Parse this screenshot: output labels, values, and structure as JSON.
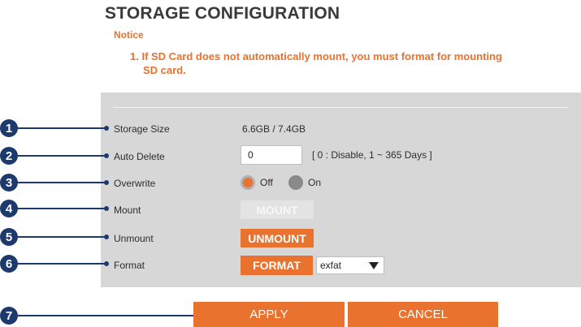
{
  "page": {
    "title": "STORAGE CONFIGURATION",
    "notice_heading": "Notice",
    "notice_line1": "1. If SD Card does not automatically mount, you must format for mounting",
    "notice_line2": "SD card."
  },
  "callouts": [
    "1",
    "2",
    "3",
    "4",
    "5",
    "6",
    "7"
  ],
  "fields": {
    "storage_size": {
      "label": "Storage Size",
      "value": "6.6GB / 7.4GB"
    },
    "auto_delete": {
      "label": "Auto Delete",
      "value": "0",
      "hint": "[ 0 : Disable, 1 ~ 365 Days ]"
    },
    "overwrite": {
      "label": "Overwrite",
      "options": [
        "Off",
        "On"
      ],
      "selected": "Off"
    },
    "mount": {
      "label": "Mount",
      "button": "MOUNT",
      "enabled": false
    },
    "unmount": {
      "label": "Unmount",
      "button": "UNMOUNT",
      "enabled": true
    },
    "format": {
      "label": "Format",
      "button": "FORMAT",
      "filesystem": "exfat"
    }
  },
  "actions": {
    "apply": "APPLY",
    "cancel": "CANCEL"
  },
  "colors": {
    "accent": "#e9722e",
    "callout": "#1c3a6e",
    "panel": "#d7d7d7"
  }
}
